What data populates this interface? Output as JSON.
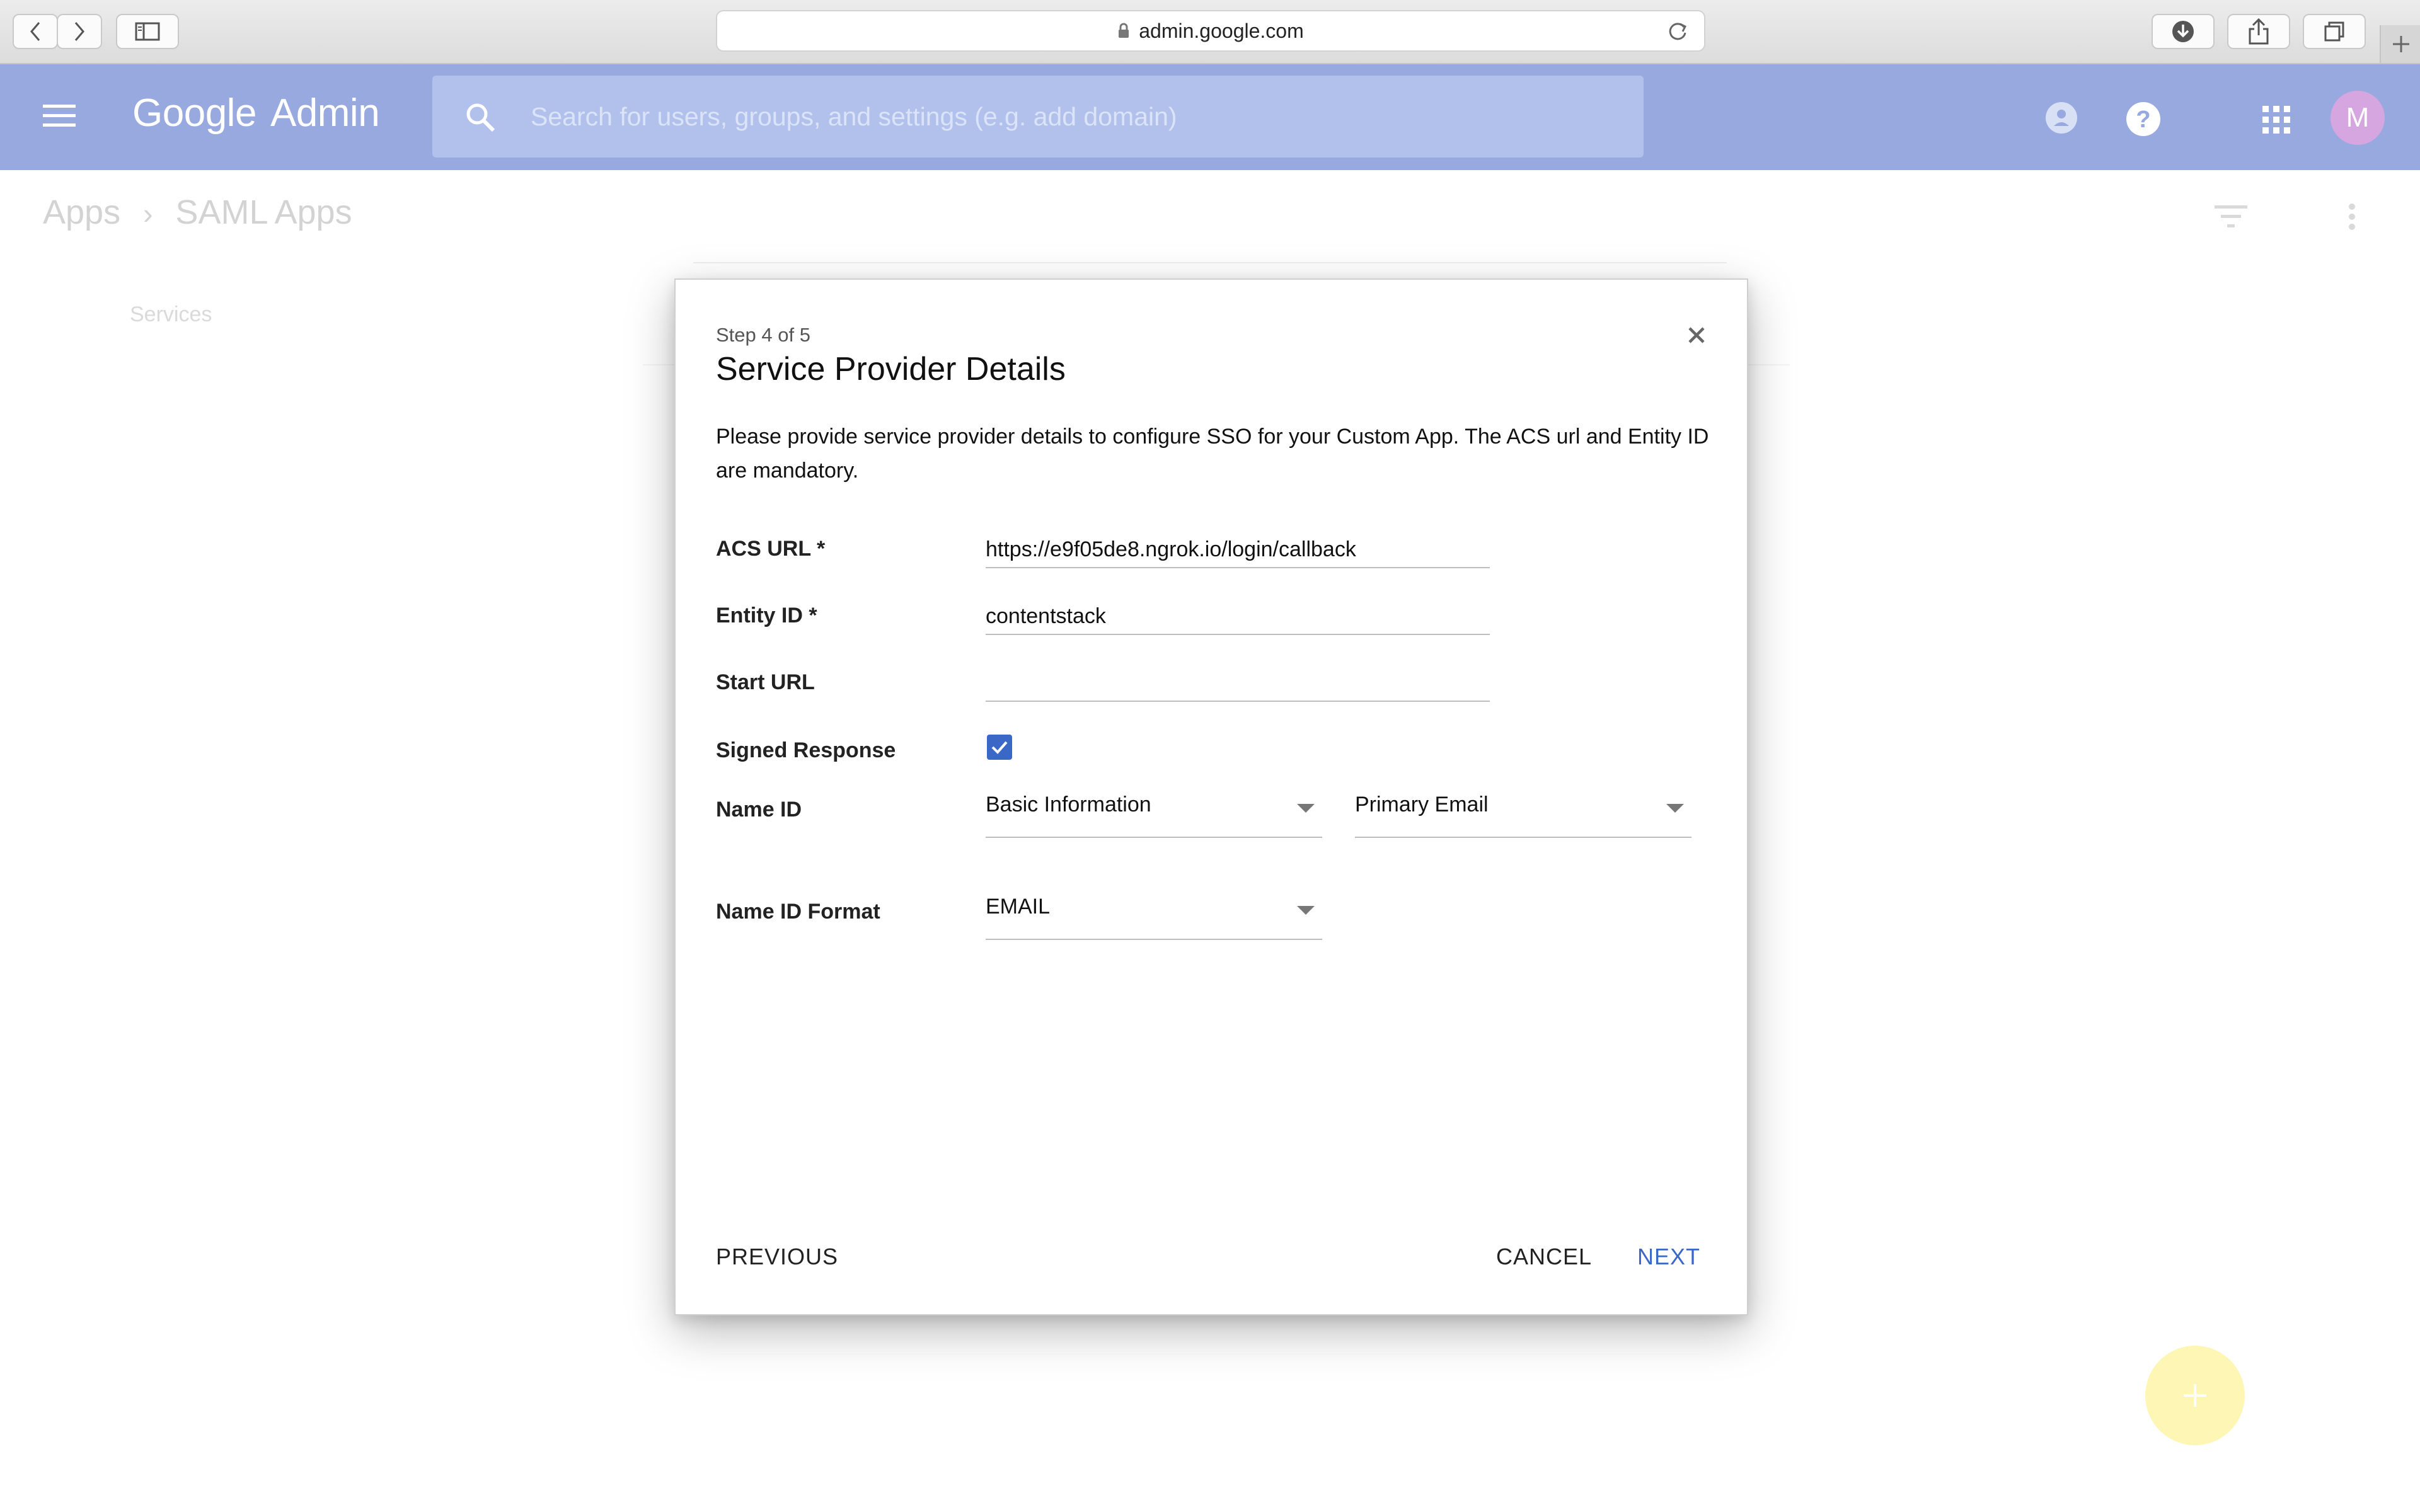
{
  "browser": {
    "url": "admin.google.com"
  },
  "header": {
    "logo_google": "Google",
    "logo_admin": "Admin",
    "search_placeholder": "Search for users, groups, and settings (e.g. add domain)",
    "avatar_initial": "M"
  },
  "breadcrumb": {
    "items": [
      "Apps",
      "SAML Apps"
    ],
    "separator": "›"
  },
  "sidebar": {
    "services_label": "Services"
  },
  "dialog": {
    "step": "Step 4 of 5",
    "title": "Service Provider Details",
    "description": "Please provide service provider details to configure SSO for your Custom App. The ACS url and Entity ID are mandatory.",
    "fields": {
      "acs_url": {
        "label": "ACS URL *",
        "value": "https://e9f05de8.ngrok.io/login/callback"
      },
      "entity_id": {
        "label": "Entity ID *",
        "value": "contentstack"
      },
      "start_url": {
        "label": "Start URL",
        "value": ""
      },
      "signed_response": {
        "label": "Signed Response",
        "checked": true
      },
      "name_id": {
        "label": "Name ID",
        "category": "Basic Information",
        "attribute": "Primary Email"
      },
      "name_id_format": {
        "label": "Name ID Format",
        "value": "EMAIL"
      }
    },
    "buttons": {
      "previous": "PREVIOUS",
      "cancel": "CANCEL",
      "next": "NEXT"
    }
  },
  "colors": {
    "header_bg": "#97a9de",
    "accent_blue": "#3b68c6",
    "avatar_bg": "#d6a6e0",
    "fab_bg": "#fdf6b4"
  }
}
